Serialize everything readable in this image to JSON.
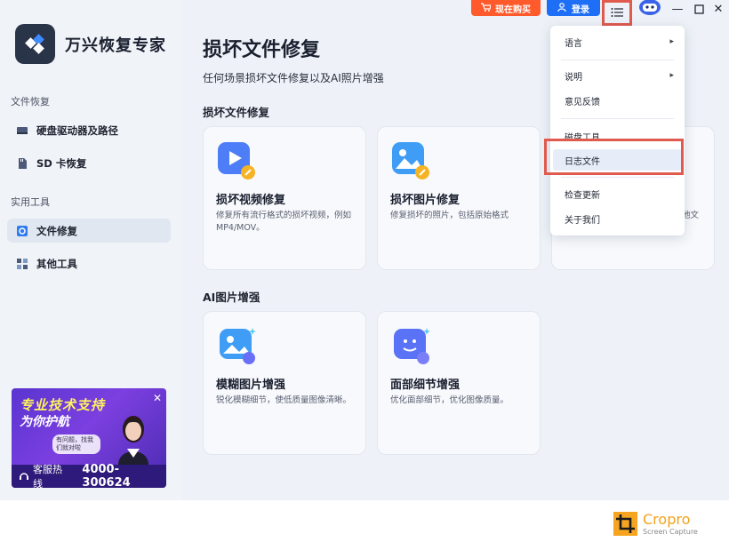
{
  "app": {
    "title": "万兴恢复专家"
  },
  "topbar": {
    "buy_label": "现在购买",
    "login_label": "登录"
  },
  "sidebar": {
    "section_recovery": "文件恢复",
    "item_disk": "硬盘驱动器及路径",
    "item_sd": "SD 卡恢复",
    "section_tools": "实用工具",
    "item_file_repair": "文件修复",
    "item_other_tools": "其他工具"
  },
  "promo": {
    "line1": "专业技术支持",
    "line2": "为你护航",
    "bubble": "有问题，找我们就对啦",
    "hotline_label": "客服热线",
    "phone": "4000-300624"
  },
  "main": {
    "title": "损坏文件修复",
    "subtitle": "任何场景损坏文件修复以及AI照片增强",
    "group1": "损坏文件修复",
    "group2": "AI图片增强",
    "cards": [
      {
        "title": "损坏视频修复",
        "desc": "修复所有流行格式的损坏视频，例如 MP4/MOV。"
      },
      {
        "title": "损坏图片修复",
        "desc": "修复损坏的照片，包括原始格式"
      },
      {
        "title": "",
        "desc": "他文"
      },
      {
        "title": "模糊图片增强",
        "desc": "锐化模糊细节，使低质量图像清晰。"
      },
      {
        "title": "面部细节增强",
        "desc": "优化面部细节，优化图像质量。"
      }
    ]
  },
  "menu": {
    "language": "语言",
    "help": "说明",
    "feedback": "意见反馈",
    "disk_tools": "磁盘工具",
    "log_file": "日志文件",
    "check_update": "检查更新",
    "about": "关于我们"
  },
  "watermark": {
    "name": "Cropro",
    "sub": "Screen Capture"
  },
  "colors": {
    "accent": "#1f6ff6",
    "buy": "#ff5a2c",
    "highlight": "#e05a4e"
  }
}
